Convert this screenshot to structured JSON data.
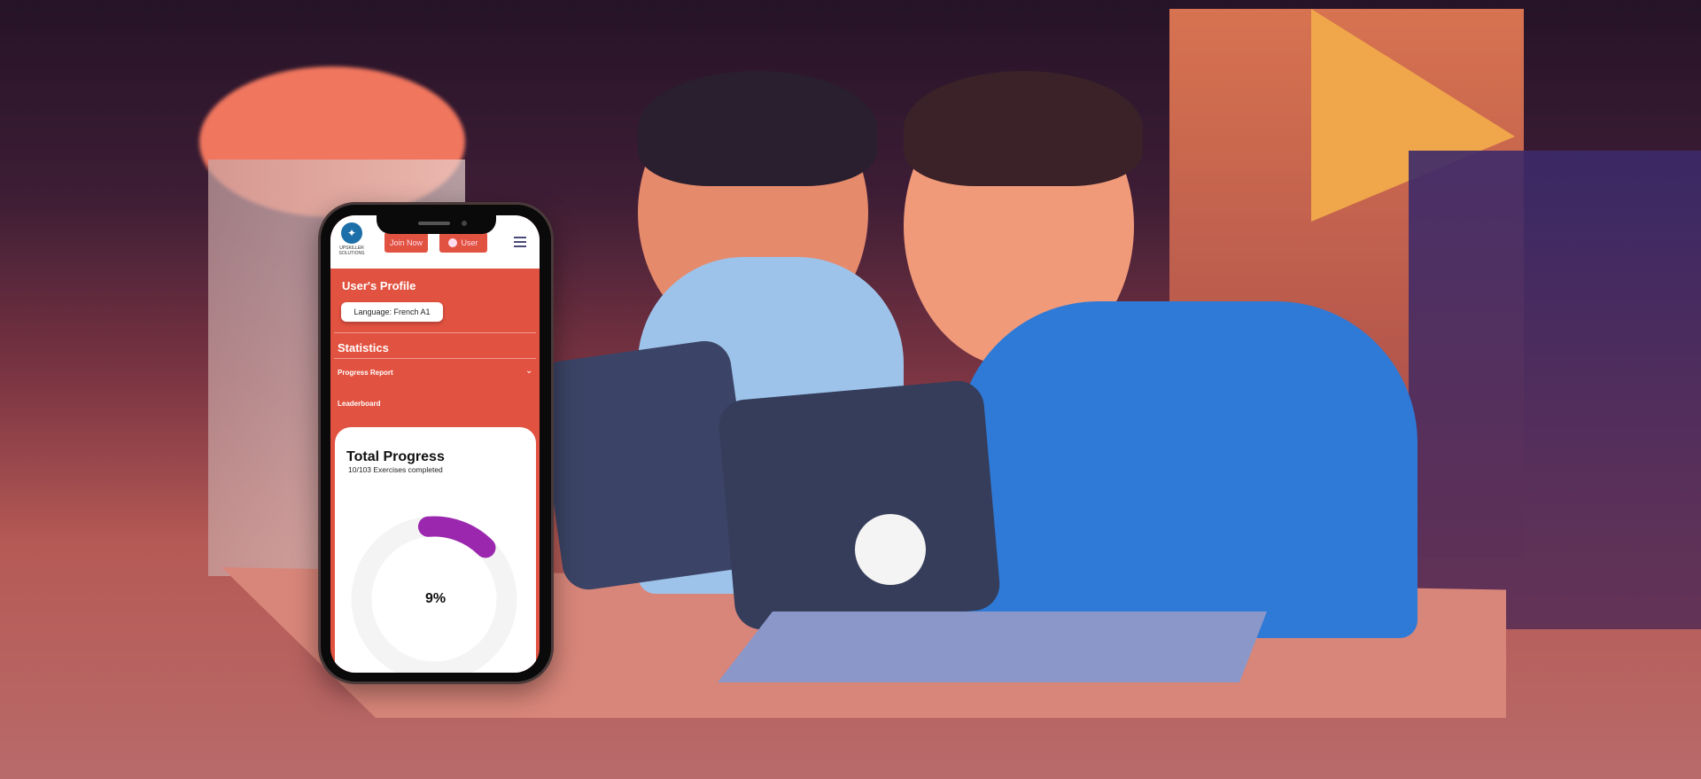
{
  "app": {
    "logo_text": "UPSKILLER SOLUTIONS",
    "brand_color": "#e25240",
    "accent_color": "#9b27af"
  },
  "header": {
    "join_label": "Join Now",
    "user_label": "User"
  },
  "profile": {
    "title": "User's Profile",
    "language_pill": "Language: French A1"
  },
  "statistics": {
    "title": "Statistics",
    "items": [
      {
        "label": "Progress Report"
      },
      {
        "label": "Leaderboard"
      }
    ]
  },
  "progress_card": {
    "title": "Total Progress",
    "subtitle": "10/103 Exercises completed",
    "percent_label": "9%",
    "percent": 9
  }
}
